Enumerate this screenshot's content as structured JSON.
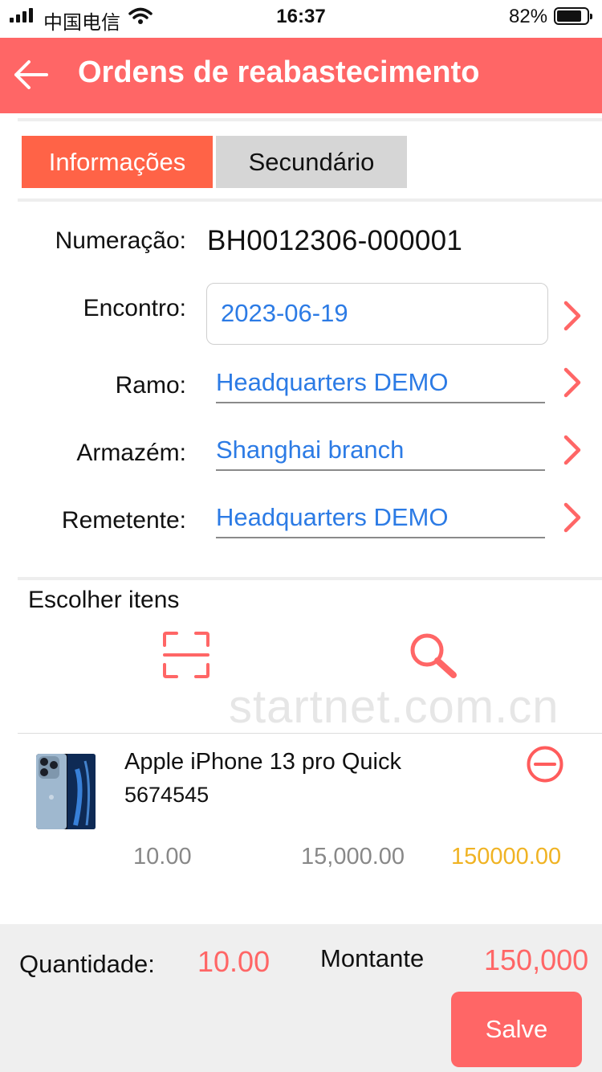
{
  "status_bar": {
    "carrier": "中国电信",
    "time": "16:37",
    "battery_percent": "82%",
    "battery_level": 0.82
  },
  "header": {
    "title": "Ordens de reabastecimento",
    "back_icon": "arrow-left-icon"
  },
  "tabs": [
    {
      "label": "Informações",
      "active": true
    },
    {
      "label": "Secundário",
      "active": false
    }
  ],
  "form": {
    "numeracao": {
      "label": "Numeração:",
      "value": "BH0012306-000001"
    },
    "encontro": {
      "label": "Encontro:",
      "value": "2023-06-19"
    },
    "ramo": {
      "label": "Ramo:",
      "value": "Headquarters DEMO"
    },
    "armazem": {
      "label": "Armazém:",
      "value": "Shanghai branch"
    },
    "remetente": {
      "label": "Remetente:",
      "value": "Headquarters DEMO"
    }
  },
  "items_section": {
    "title": "Escolher itens",
    "scan_icon": "scan-icon",
    "search_icon": "search-icon",
    "watermark": "startnet.com.cn"
  },
  "items": [
    {
      "name": "Apple iPhone 13 pro Quick",
      "code": "5674545",
      "quantity": "10.00",
      "price": "15,000.00",
      "total": "150000.00",
      "remove_icon": "minus-circle-icon"
    }
  ],
  "footer": {
    "quantity_label": "Quantidade:",
    "quantity_value": "10.00",
    "amount_label": "Montante",
    "amount_value": "150,000",
    "save_label": "Salve"
  },
  "colors": {
    "accent": "#ff6666",
    "active_tab": "#ff6347",
    "link_blue": "#2c7be5",
    "total_yellow": "#f0b323"
  }
}
